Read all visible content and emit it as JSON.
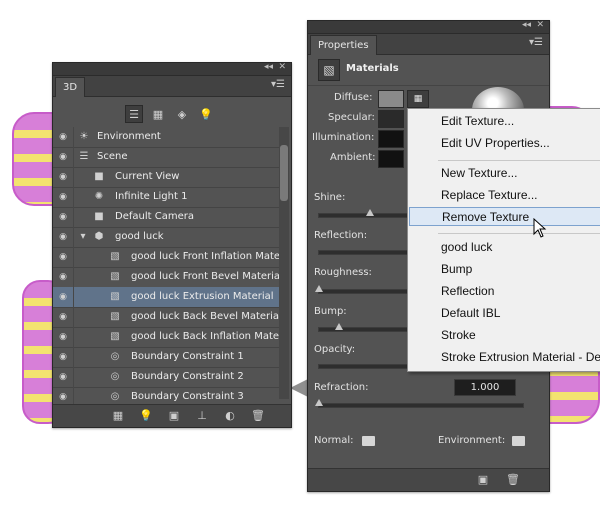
{
  "panel3d": {
    "title": "3D",
    "title_controls": "◂◂ ✕",
    "menu_icon": "menu-lines-icon",
    "toolbar": [
      "scene-filter-icon",
      "mesh-filter-icon",
      "material-filter-icon",
      "light-filter-icon"
    ],
    "rows": [
      {
        "label": "Environment",
        "icon": "environment-icon"
      },
      {
        "label": "Scene",
        "icon": "scene-icon"
      },
      {
        "label": "Current View",
        "icon": "camera-icon"
      },
      {
        "label": "Infinite Light 1",
        "icon": "light-icon"
      },
      {
        "label": "Default Camera",
        "icon": "camera-icon"
      },
      {
        "label": "good luck",
        "icon": "mesh-icon"
      },
      {
        "label": "good luck Front Inflation Mate...",
        "icon": "material-icon"
      },
      {
        "label": "good luck Front Bevel Material",
        "icon": "material-icon"
      },
      {
        "label": "good luck Extrusion Material",
        "icon": "material-icon"
      },
      {
        "label": "good luck Back Bevel Material",
        "icon": "material-icon"
      },
      {
        "label": "good luck Back Inflation Mate...",
        "icon": "material-icon"
      },
      {
        "label": "Boundary Constraint 1",
        "icon": "constraint-icon"
      },
      {
        "label": "Boundary Constraint 2",
        "icon": "constraint-icon"
      },
      {
        "label": "Boundary Constraint 3",
        "icon": "constraint-icon"
      }
    ],
    "bottom_icons": [
      "render-icon",
      "light-add-icon",
      "mesh-add-icon",
      "move-to-ground-icon",
      "new-light-icon",
      "trash-icon"
    ]
  },
  "properties": {
    "tab": "Properties",
    "section_title": "Materials",
    "labels": {
      "diffuse": "Diffuse:",
      "specular": "Specular:",
      "illumination": "Illumination:",
      "ambient": "Ambient:",
      "shine": "Shine:",
      "reflection": "Reflection:",
      "roughness": "Roughness:",
      "bump": "Bump:",
      "opacity": "Opacity:",
      "refraction": "Refraction:",
      "normal": "Normal:",
      "environment": "Environment:"
    },
    "refraction_value": "1.000",
    "bottom_icons": [
      "render-icon",
      "trash-icon"
    ]
  },
  "context_menu": {
    "group1": [
      "Edit Texture...",
      "Edit UV Properties..."
    ],
    "group2": [
      "New Texture...",
      "Replace Texture...",
      "Remove Texture"
    ],
    "group3": [
      "good luck",
      "Bump",
      "Reflection",
      "Default IBL",
      "Stroke",
      "Stroke Extrusion Material - Def"
    ],
    "highlighted": "Remove Texture"
  },
  "colors": {
    "panel_bg": "#535353",
    "selected_row": "#60738a",
    "menu_bg": "#f0f0f0",
    "menu_highlight": "#dde8f5",
    "text_pink": "#d77fd8",
    "text_yellow": "#f3e370"
  }
}
